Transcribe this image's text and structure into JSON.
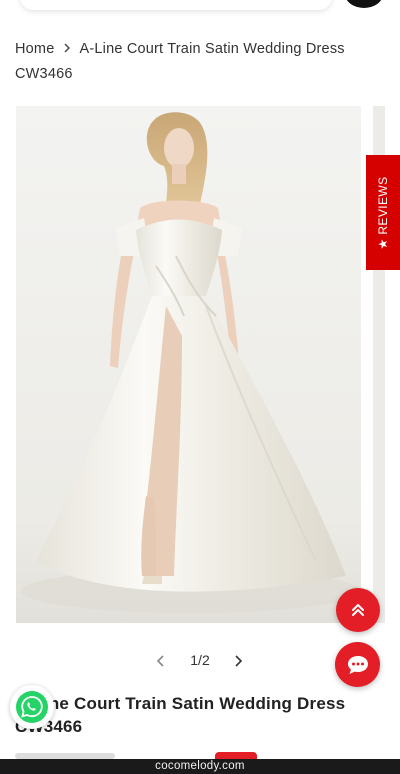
{
  "breadcrumb": {
    "home": "Home",
    "current": "A-Line Court Train Satin Wedding Dress CW3466"
  },
  "gallery": {
    "current_index": 1,
    "total": 2,
    "counter_text": "1/2"
  },
  "reviews_tab": {
    "label": "★ REVIEWS",
    "color": "#d50000"
  },
  "product": {
    "title": "A-Line Court Train Satin Wedding Dress CW3466"
  },
  "floating": {
    "accent": "#e31e26",
    "scroll_top_icon": "double-chevron-up-icon",
    "chat_icon": "chat-bubble-icon",
    "whatsapp_icon": "whatsapp-icon"
  },
  "browser": {
    "url": "cocomelody.com"
  }
}
